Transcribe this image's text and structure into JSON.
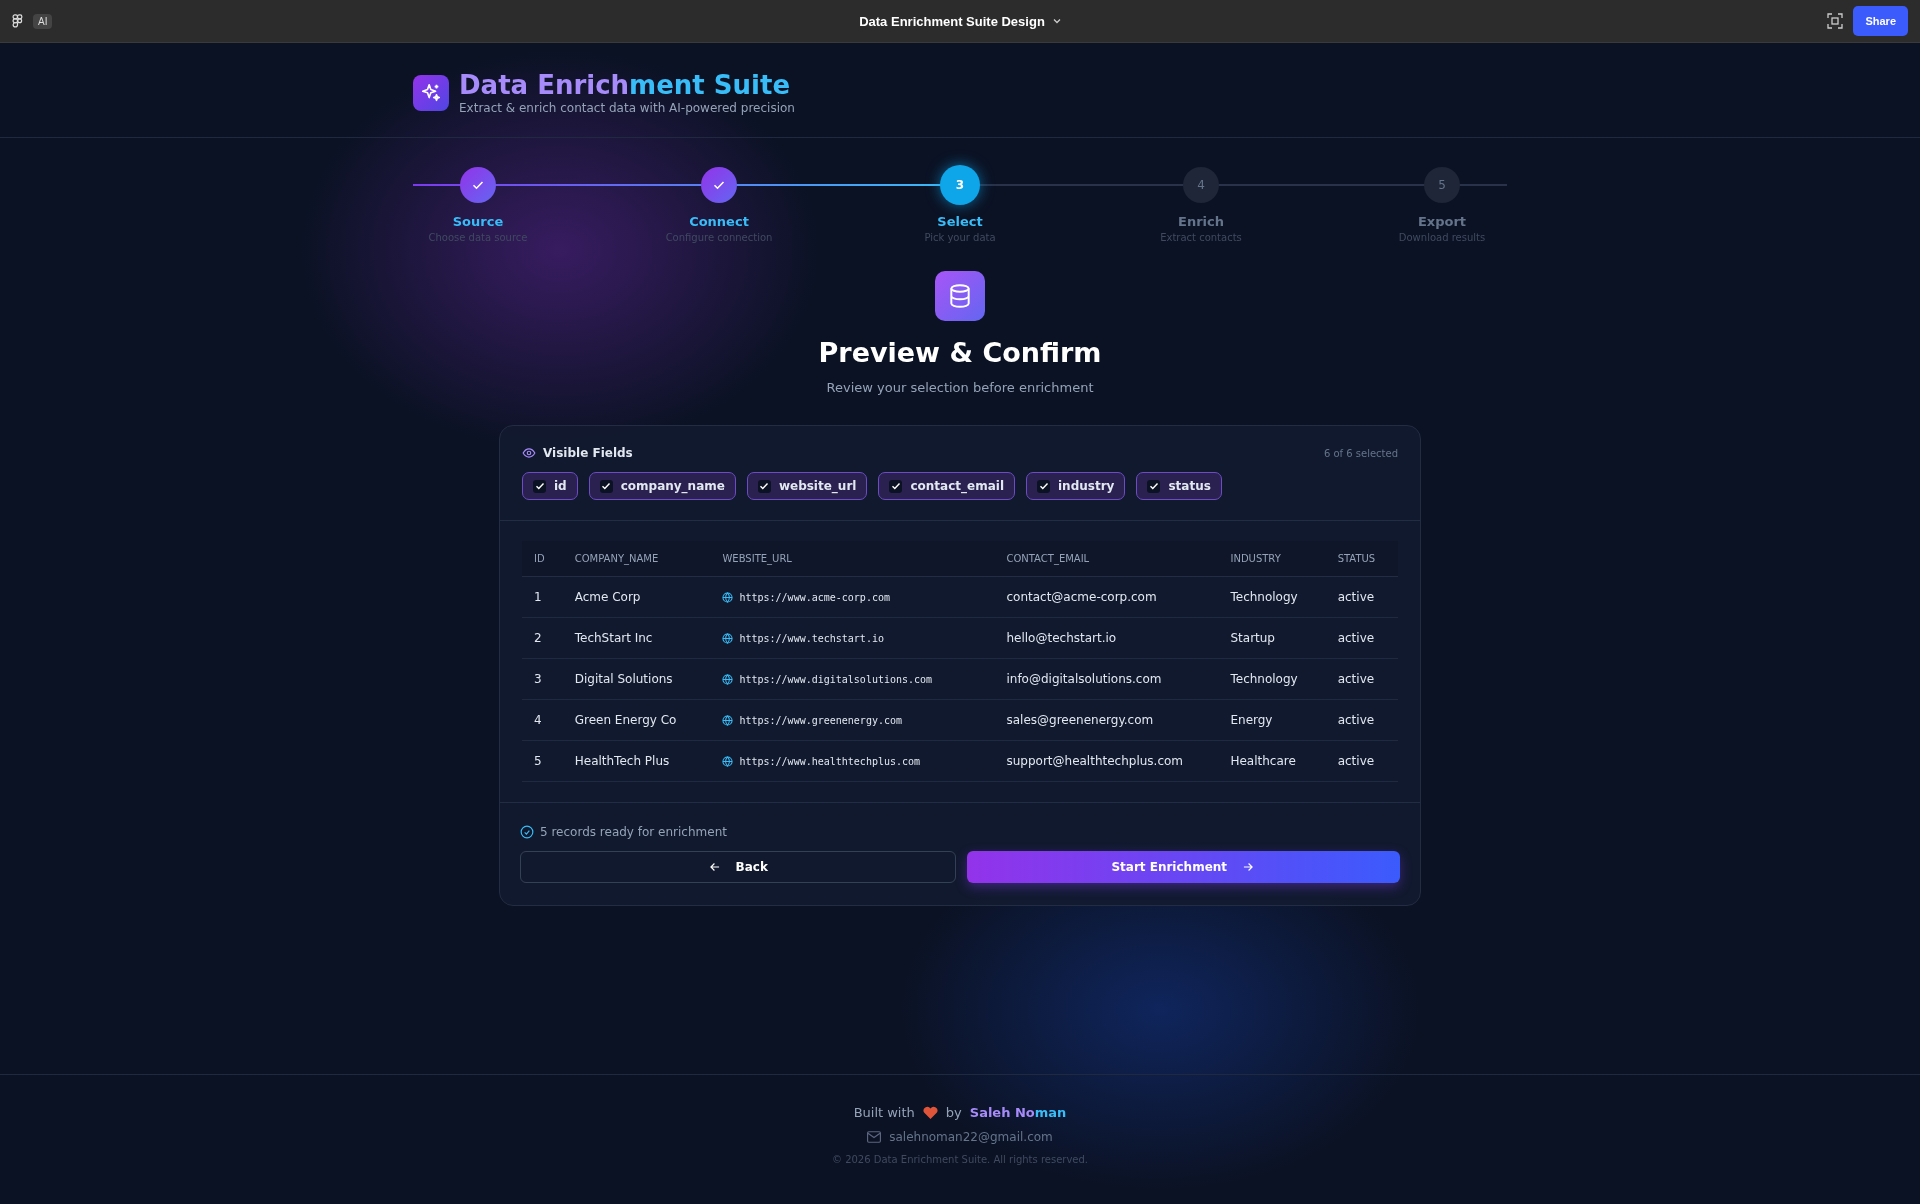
{
  "topbar": {
    "ai_badge": "AI",
    "title": "Data Enrichment Suite Design",
    "share": "Share"
  },
  "header": {
    "title_a": "Data Enrich",
    "title_b": "ment Suite",
    "subtitle": "Extract & enrich contact data with AI-powered precision"
  },
  "steps": [
    {
      "label": "Source",
      "sub": "Choose data source",
      "completed": true,
      "selected": false
    },
    {
      "label": "Connect",
      "sub": "Configure connection",
      "completed": true,
      "selected": false
    },
    {
      "number": "3",
      "label": "Select",
      "sub": "Pick your data",
      "completed": false,
      "selected": true
    },
    {
      "number": "4",
      "label": "Enrich",
      "sub": "Extract contacts",
      "completed": false,
      "selected": false
    },
    {
      "number": "5",
      "label": "Export",
      "sub": "Download results",
      "completed": false,
      "selected": false
    }
  ],
  "heading": "Preview & Confirm",
  "subheading": "Review your selection before enrichment",
  "fields": {
    "title": "Visible Fields",
    "count": "6 of 6 selected",
    "items": [
      {
        "label": "id",
        "checked": true
      },
      {
        "label": "company_name",
        "checked": true
      },
      {
        "label": "website_url",
        "checked": true
      },
      {
        "label": "contact_email",
        "checked": true
      },
      {
        "label": "industry",
        "checked": true
      },
      {
        "label": "status",
        "checked": true
      }
    ]
  },
  "table": {
    "columns": [
      "ID",
      "COMPANY_NAME",
      "WEBSITE_URL",
      "CONTACT_EMAIL",
      "INDUSTRY",
      "STATUS"
    ],
    "rows": [
      [
        "1",
        "Acme Corp",
        "https://www.acme-corp.com",
        "contact@acme-corp.com",
        "Technology",
        "active"
      ],
      [
        "2",
        "TechStart Inc",
        "https://www.techstart.io",
        "hello@techstart.io",
        "Startup",
        "active"
      ],
      [
        "3",
        "Digital Solutions",
        "https://www.digitalsolutions.com",
        "info@digitalsolutions.com",
        "Technology",
        "active"
      ],
      [
        "4",
        "Green Energy Co",
        "https://www.greenenergy.com",
        "sales@greenenergy.com",
        "Energy",
        "active"
      ],
      [
        "5",
        "HealthTech Plus",
        "https://www.healthtechplus.com",
        "support@healthtechplus.com",
        "Healthcare",
        "active"
      ]
    ]
  },
  "ready": "5 records ready for enrichment",
  "back": "Back",
  "start": "Start Enrichment",
  "footer": {
    "built": "Built with",
    "by": "by",
    "author_a": "Saleh No",
    "author_b": "man",
    "email": "salehnoman22@gmail.com",
    "copyright": "© 2026 Data Enrichment Suite. All rights reserved."
  }
}
